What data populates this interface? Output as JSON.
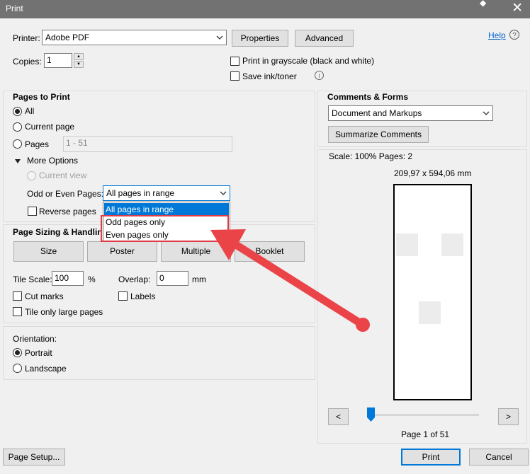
{
  "window": {
    "title": "Print"
  },
  "printer": {
    "label": "Printer:",
    "selected": "Adobe PDF",
    "properties_label": "Properties",
    "advanced_label": "Advanced",
    "help_label": "Help"
  },
  "copies": {
    "label": "Copies:",
    "value": "1"
  },
  "options": {
    "grayscale_label": "Print in grayscale (black and white)",
    "save_ink_label": "Save ink/toner"
  },
  "pages_to_print": {
    "heading": "Pages to Print",
    "all_label": "All",
    "current_page_label": "Current page",
    "pages_label": "Pages",
    "pages_value": "1 - 51",
    "more_options_label": "More Options",
    "current_view_label": "Current view",
    "odd_even_label": "Odd or Even Pages:",
    "odd_even_selected": "All pages in range",
    "odd_even_options": [
      "All pages in range",
      "Odd pages only",
      "Even pages only"
    ],
    "reverse_pages_label": "Reverse pages"
  },
  "page_sizing": {
    "heading": "Page Sizing & Handling",
    "modes": [
      "Size",
      "Poster",
      "Multiple",
      "Booklet"
    ],
    "tile_scale_label": "Tile Scale:",
    "tile_scale_value": "100",
    "tile_scale_unit": "%",
    "overlap_label": "Overlap:",
    "overlap_value": "0",
    "overlap_unit": "mm",
    "cut_marks_label": "Cut marks",
    "labels_label": "Labels",
    "tile_only_large_label": "Tile only large pages"
  },
  "orientation": {
    "heading": "Orientation:",
    "portrait_label": "Portrait",
    "landscape_label": "Landscape"
  },
  "comments_forms": {
    "heading": "Comments & Forms",
    "selected": "Document and Markups",
    "summarize_label": "Summarize Comments"
  },
  "preview": {
    "scale_text": "Scale: 100% Pages: 2",
    "dimensions": "209,97 x 594,06 mm",
    "prev_label": "<",
    "next_label": ">",
    "page_indicator": "Page 1 of 51",
    "slider_position": 0.0
  },
  "footer": {
    "page_setup_label": "Page Setup...",
    "print_label": "Print",
    "cancel_label": "Cancel"
  },
  "colors": {
    "accent": "#0078d7",
    "annotation": "#e03c48",
    "titlebar": "#727272"
  },
  "icons": [
    "close-icon",
    "help-icon",
    "info-icon",
    "chevron-down-icon",
    "triangle-down-icon",
    "annotation-arrow-icon"
  ]
}
